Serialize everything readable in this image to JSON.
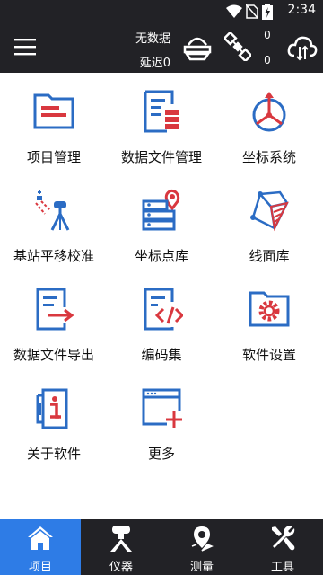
{
  "status_bar": {
    "time": "2:34"
  },
  "header": {
    "data_status": "无数据",
    "latency": "延迟0",
    "receiver_count": "0",
    "satellite_count": "0"
  },
  "menu": [
    {
      "label": "项目管理",
      "icon": "project-folder-icon"
    },
    {
      "label": "数据文件管理",
      "icon": "data-file-icon"
    },
    {
      "label": "坐标系统",
      "icon": "coordinate-system-icon"
    },
    {
      "label": "基站平移校准",
      "icon": "base-station-icon"
    },
    {
      "label": "坐标点库",
      "icon": "point-library-icon"
    },
    {
      "label": "线面库",
      "icon": "line-surface-icon"
    },
    {
      "label": "数据文件导出",
      "icon": "file-export-icon"
    },
    {
      "label": "编码集",
      "icon": "code-set-icon"
    },
    {
      "label": "软件设置",
      "icon": "settings-folder-icon"
    },
    {
      "label": "关于软件",
      "icon": "about-icon"
    },
    {
      "label": "更多",
      "icon": "more-icon"
    }
  ],
  "nav": [
    {
      "label": "项目",
      "icon": "home-icon",
      "active": true
    },
    {
      "label": "仪器",
      "icon": "instrument-icon",
      "active": false
    },
    {
      "label": "测量",
      "icon": "location-pin-icon",
      "active": false
    },
    {
      "label": "工具",
      "icon": "tools-icon",
      "active": false
    }
  ],
  "colors": {
    "blue": "#2b6cc4",
    "red": "#d9383f",
    "bar": "#222226",
    "active_tab": "#2e7ce6"
  }
}
